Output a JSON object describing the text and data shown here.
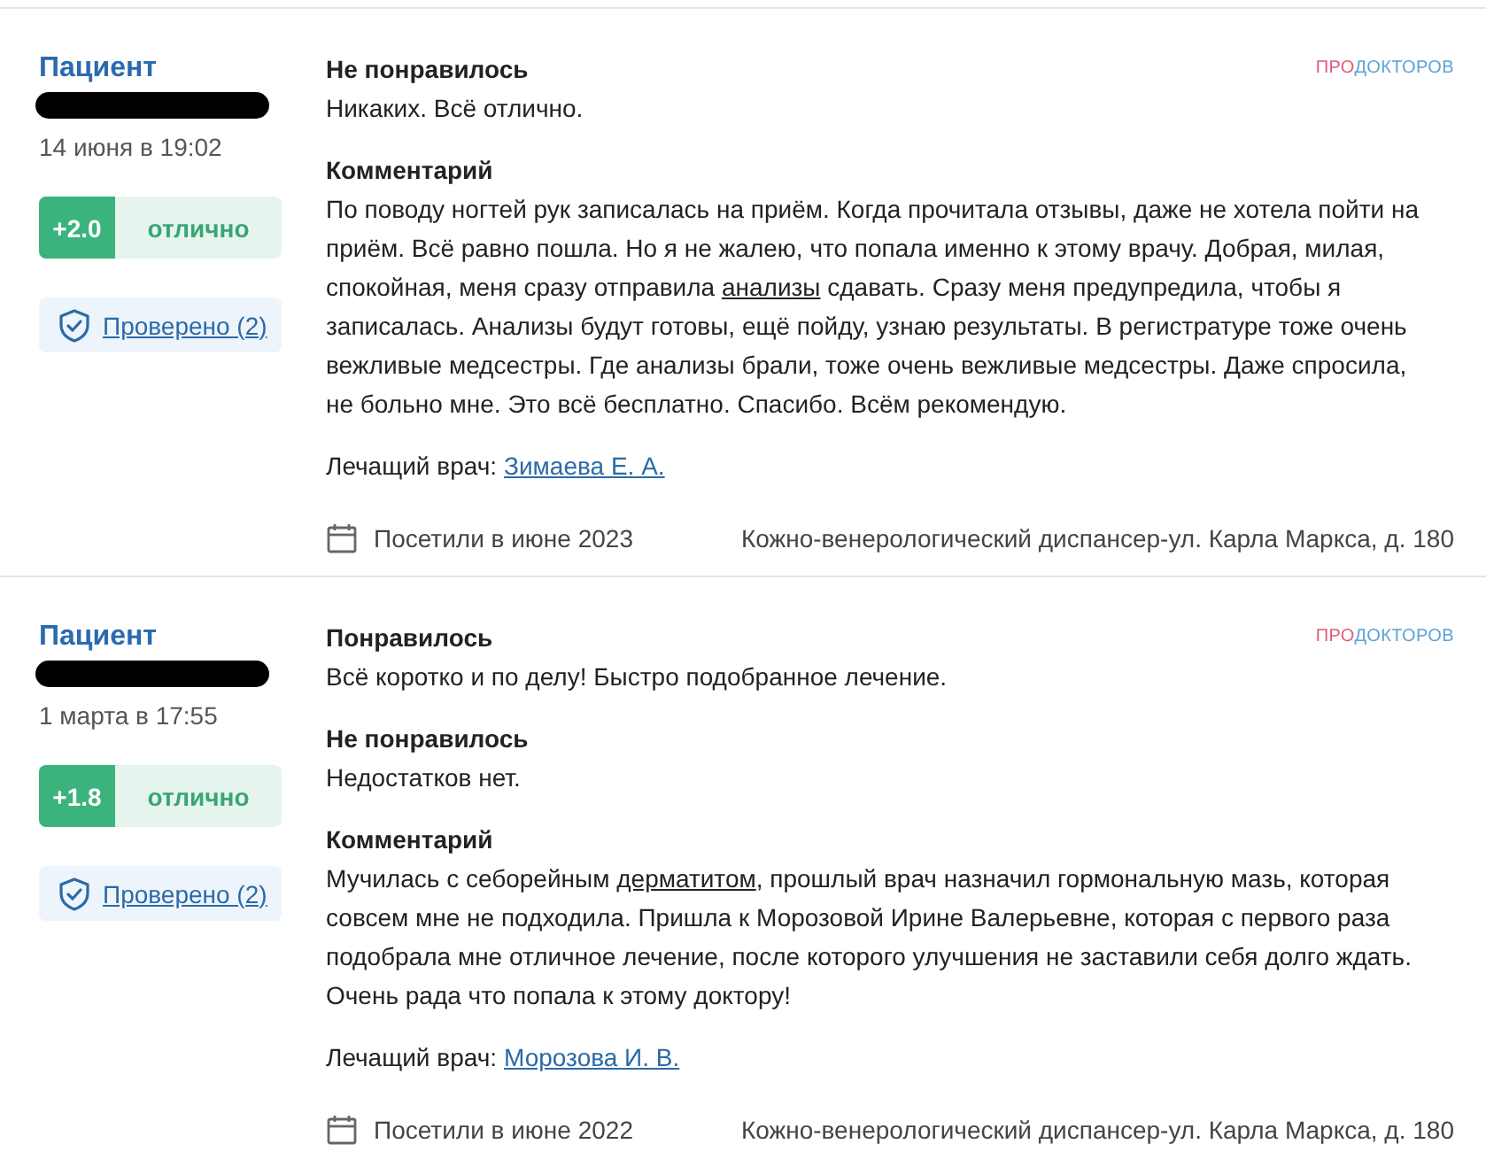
{
  "reviews": [
    {
      "author": "Пациент",
      "date": "14 июня в 19:02",
      "score": "+2.0",
      "score_label": "отлично",
      "verified": "Проверено (2)",
      "source": [
        "ПРО",
        "ДОКТОРОВ"
      ],
      "sections": [
        {
          "title": "Не понравилось",
          "parts": [
            {
              "kind": "plain",
              "text": "Никаких. Всё отлично."
            }
          ]
        },
        {
          "title": "Комментарий",
          "parts": [
            {
              "kind": "plain",
              "text": "По поводу ногтей рук записалась на приём. Когда прочитала отзывы, даже не хотела пойти на приём. Всё равно пошла. Но я не жалею, что попала именно к этому врачу. Добрая, милая, спокойная, меня сразу отправила "
            },
            {
              "kind": "term",
              "text": "анализы"
            },
            {
              "kind": "plain",
              "text": " сдавать. Сразу меня предупредила, чтобы я записалась. Анализы будут готовы, ещё пойду, узнаю результаты. В регистратуре тоже очень вежливые медсестры. Где анализы брали, тоже очень вежливые медсестры. Даже спросила, не больно мне. Это всё бесплатно. Спасибо. Всём рекомендую."
            }
          ]
        }
      ],
      "doctor_label": "Лечащий врач:",
      "doctor": "Зимаева Е. А.",
      "visit": "Посетили в июне 2023",
      "clinic": "Кожно-венерологический диспансер-ул. Карла Маркса, д. 180"
    },
    {
      "author": "Пациент",
      "date": "1 марта в 17:55",
      "score": "+1.8",
      "score_label": "отлично",
      "verified": "Проверено (2)",
      "source": [
        "ПРО",
        "ДОКТОРОВ"
      ],
      "sections": [
        {
          "title": "Понравилось",
          "parts": [
            {
              "kind": "plain",
              "text": "Всё коротко и по делу! Быстро подобранное лечение."
            }
          ]
        },
        {
          "title": "Не понравилось",
          "parts": [
            {
              "kind": "plain",
              "text": "Недостатков нет."
            }
          ]
        },
        {
          "title": "Комментарий",
          "parts": [
            {
              "kind": "plain",
              "text": "Мучилась с себорейным "
            },
            {
              "kind": "term",
              "text": "дерматитом"
            },
            {
              "kind": "plain",
              "text": ", прошлый врач назначил гормональную мазь, которая совсем мне не подходила. Пришла к Морозовой Ирине Валерьевне, которая с первого раза подобрала мне отличное лечение, после которого улучшения не заставили себя долго ждать. Очень рада что попала к этому доктору!"
            }
          ]
        }
      ],
      "doctor_label": "Лечащий врач:",
      "doctor": "Морозова И. В.",
      "visit": "Посетили в июне 2022",
      "clinic": "Кожно-венерологический диспансер-ул. Карла Маркса, д. 180"
    }
  ]
}
